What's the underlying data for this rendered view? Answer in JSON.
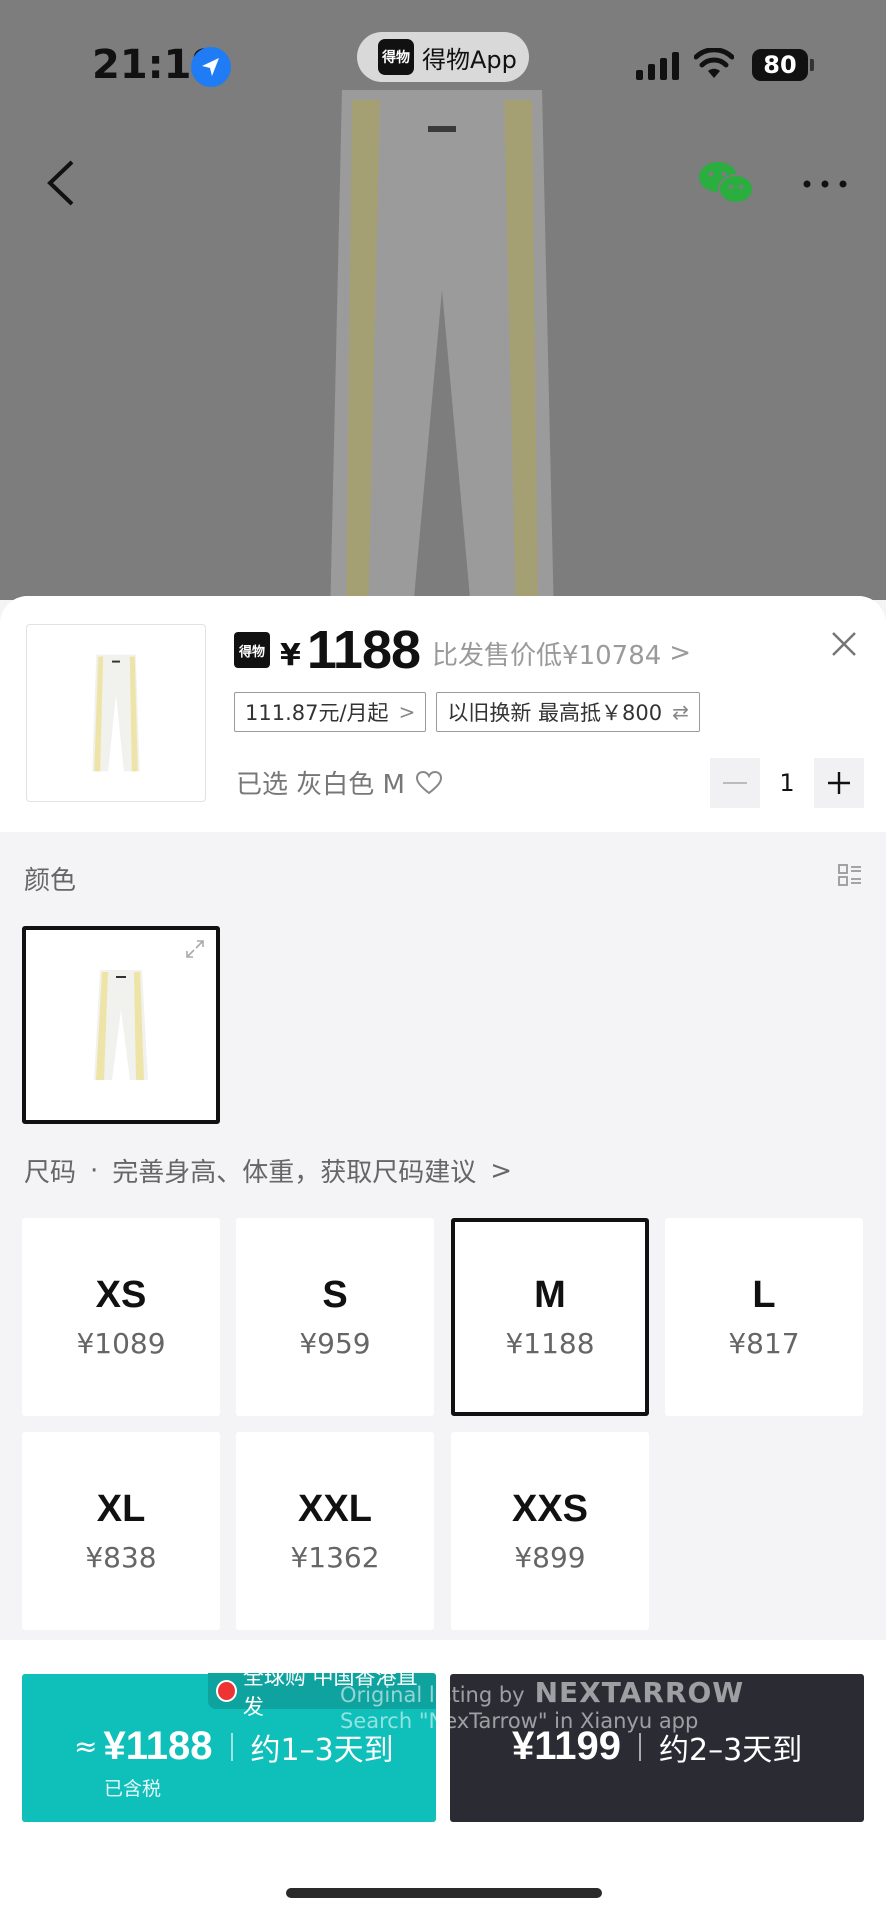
{
  "status_bar": {
    "time": "21:19",
    "app_pill_logo": "得物",
    "app_pill_name": "得物App",
    "battery": "80"
  },
  "header": {
    "brand_logo": "得物",
    "currency": "¥",
    "price": "1188",
    "compare_text": "比发售价低¥10784",
    "compare_chevron": ">",
    "installment_tag": "111.87元/月起",
    "installment_chevron": ">",
    "tradein_tag": "以旧换新 最高抵￥800",
    "tradein_icon": "⇄",
    "selected_label": "已选 灰白色 M",
    "quantity": "1"
  },
  "color_section": {
    "label": "颜色"
  },
  "size_section": {
    "label": "尺码",
    "dot": "·",
    "hint": "完善身高、体重，获取尺码建议",
    "hint_chevron": ">",
    "sizes": [
      {
        "name": "XS",
        "price": "¥1089"
      },
      {
        "name": "S",
        "price": "¥959"
      },
      {
        "name": "M",
        "price": "¥1188"
      },
      {
        "name": "L",
        "price": "¥817"
      },
      {
        "name": "XL",
        "price": "¥838"
      },
      {
        "name": "XXL",
        "price": "¥1362"
      },
      {
        "name": "XXS",
        "price": "¥899"
      }
    ],
    "selected_size": "M"
  },
  "actions": {
    "global_badge": "全球购 中国香港直发",
    "teal_approx": "≈",
    "teal_price": "¥1188",
    "teal_eta": "约1–3天到",
    "teal_tax": "已含税",
    "dark_price": "¥1199",
    "dark_eta": "约2–3天到"
  },
  "watermark": {
    "line1": "Original listing by",
    "brand": "NEXTARROW",
    "line2": "Search \"NexTarrow\" in Xianyu app"
  },
  "colors": {
    "teal": "#0fbfba",
    "dark": "#2b2b33",
    "overlay": "#7d7d7d",
    "wechat_green": "#2aae3f",
    "location_blue": "#1f7cf5"
  },
  "icons": [
    "location-arrow-icon",
    "signal-icon",
    "wifi-icon",
    "battery-icon",
    "back-icon",
    "wechat-icon",
    "more-icon",
    "close-icon",
    "heart-icon",
    "minus-icon",
    "plus-icon",
    "grid-icon",
    "expand-icon",
    "hk-flag-icon"
  ]
}
